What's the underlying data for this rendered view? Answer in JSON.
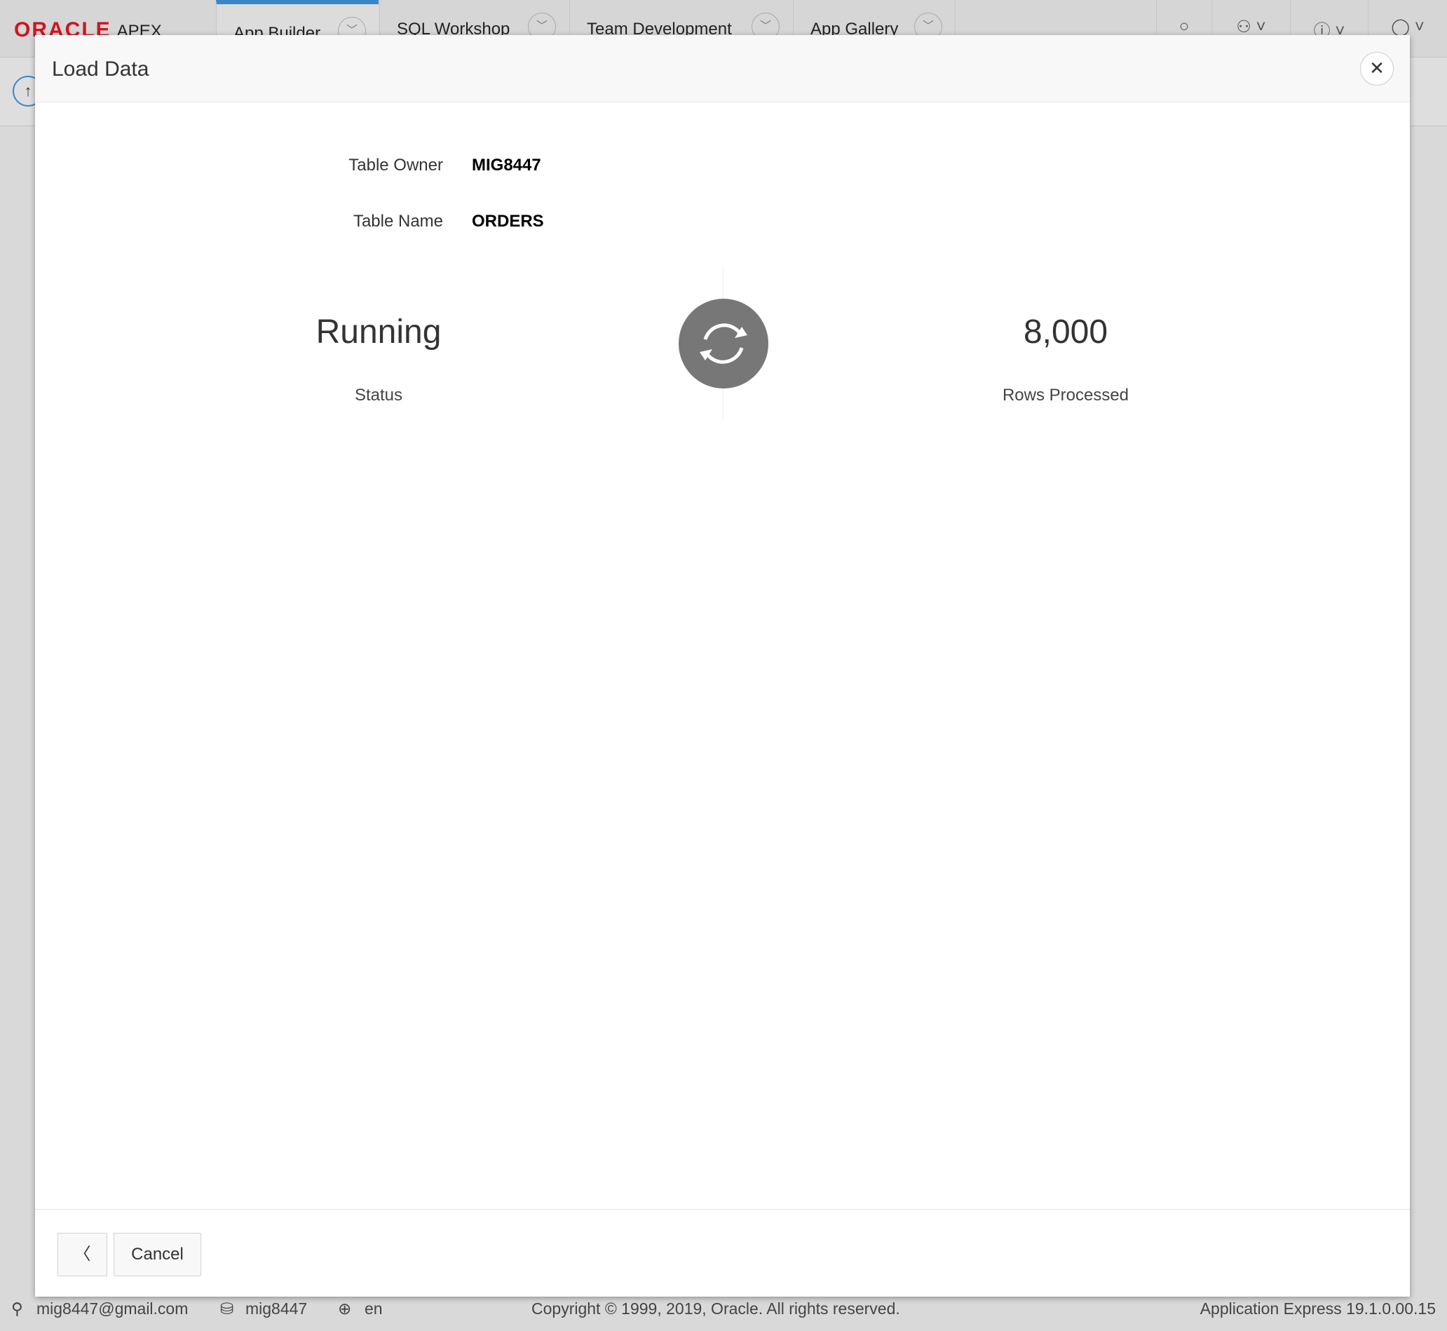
{
  "app": {
    "logo": "ORACLE",
    "logo_suffix": "APEX"
  },
  "tabs": [
    {
      "label": "App Builder",
      "active": true
    },
    {
      "label": "SQL Workshop"
    },
    {
      "label": "Team Development"
    },
    {
      "label": "App Gallery"
    }
  ],
  "modal": {
    "title": "Load Data",
    "table_owner_label": "Table Owner",
    "table_owner": "MIG8447",
    "table_name_label": "Table Name",
    "table_name": "ORDERS",
    "status_value": "Running",
    "status_label": "Status",
    "rows_value": "8,000",
    "rows_label": "Rows Processed",
    "cancel_label": "Cancel"
  },
  "footer": {
    "user": "mig8447@gmail.com",
    "schema": "mig8447",
    "language": "en",
    "copyright": "Copyright © 1999, 2019, Oracle. All rights reserved.",
    "version": "Application Express 19.1.0.00.15"
  }
}
